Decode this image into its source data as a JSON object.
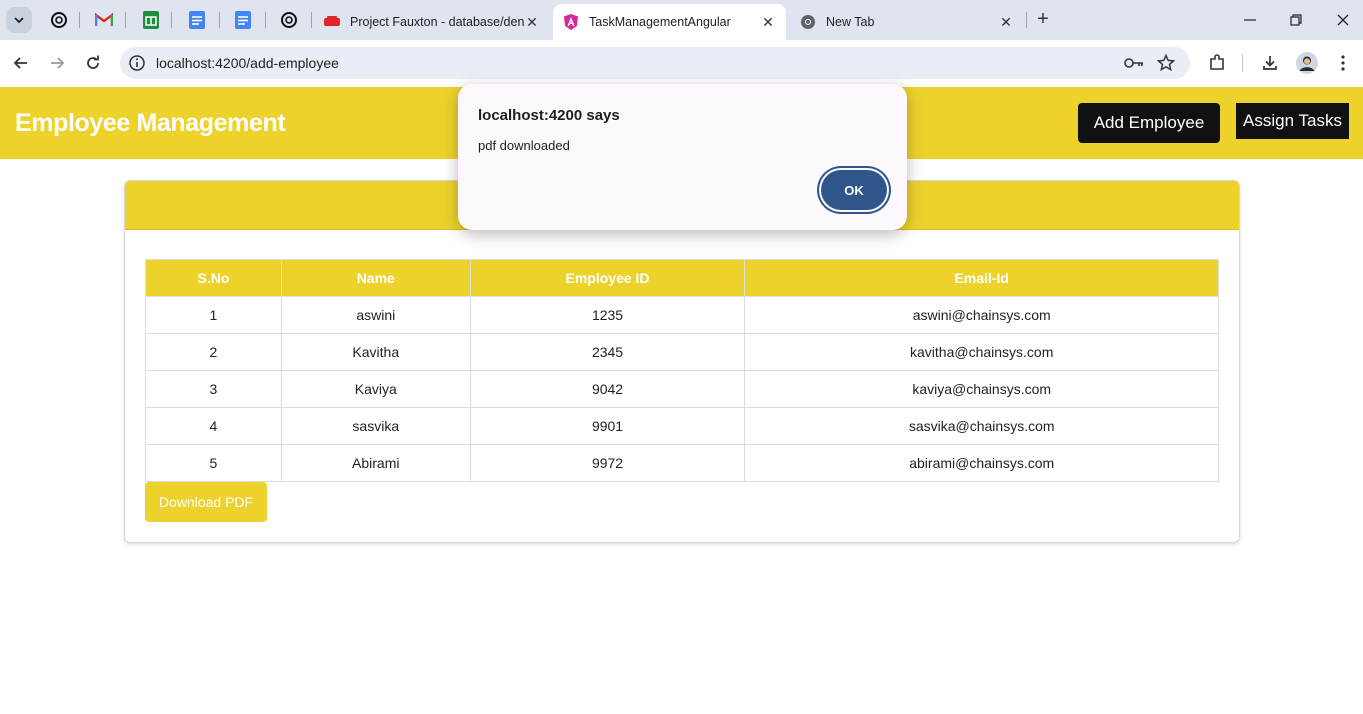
{
  "browser": {
    "tabs": [
      {
        "title": "Project Fauxton - database/den",
        "active": false
      },
      {
        "title": "TaskManagementAngular",
        "active": true
      },
      {
        "title": "New Tab",
        "active": false
      }
    ],
    "url": "localhost:4200/add-employee"
  },
  "header": {
    "title": "Employee Management",
    "add_employee": "Add Employee",
    "assign_tasks": "Assign Tasks"
  },
  "table": {
    "columns": [
      "S.No",
      "Name",
      "Employee ID",
      "Email-Id"
    ],
    "rows": [
      [
        "1",
        "aswini",
        "1235",
        "aswini@chainsys.com"
      ],
      [
        "2",
        "Kavitha",
        "2345",
        "kavitha@chainsys.com"
      ],
      [
        "3",
        "Kaviya",
        "9042",
        "kaviya@chainsys.com"
      ],
      [
        "4",
        "sasvika",
        "9901",
        "sasvika@chainsys.com"
      ],
      [
        "5",
        "Abirami",
        "9972",
        "abirami@chainsys.com"
      ]
    ]
  },
  "download_pdf": "Download PDF",
  "dialog": {
    "title": "localhost:4200 says",
    "message": "pdf downloaded",
    "ok": "OK"
  },
  "colors": {
    "accent": "#edd22c",
    "button_dark": "#111111",
    "dialog_button": "#2f568a"
  }
}
